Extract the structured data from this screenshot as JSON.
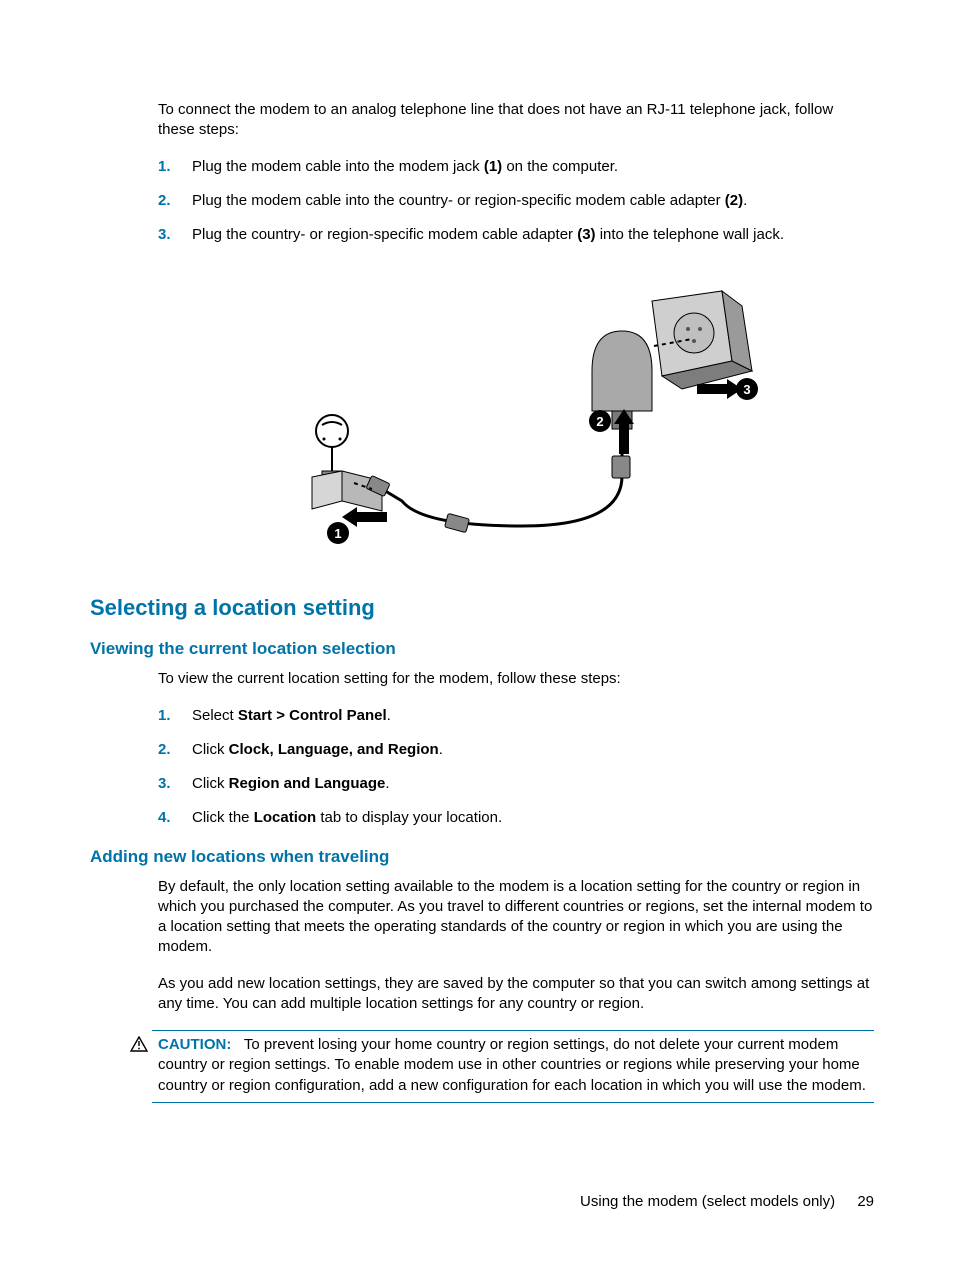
{
  "intro": "To connect the modem to an analog telephone line that does not have an RJ-11 telephone jack, follow these steps:",
  "steps1": [
    {
      "pre": "Plug the modem cable into the modem jack ",
      "bold": "(1)",
      "post": " on the computer."
    },
    {
      "pre": "Plug the modem cable into the country- or region-specific modem cable adapter ",
      "bold": "(2)",
      "post": "."
    },
    {
      "pre": "Plug the country- or region-specific modem cable adapter ",
      "bold": "(3)",
      "post": " into the telephone wall jack."
    }
  ],
  "h2": "Selecting a location setting",
  "h3a": "Viewing the current location selection",
  "view_intro": "To view the current location setting for the modem, follow these steps:",
  "steps2": [
    {
      "pre": "Select ",
      "bold": "Start > Control Panel",
      "post": "."
    },
    {
      "pre": "Click ",
      "bold": "Clock, Language, and Region",
      "post": "."
    },
    {
      "pre": "Click ",
      "bold": "Region and Language",
      "post": "."
    },
    {
      "pre": "Click the ",
      "bold": "Location",
      "post": " tab to display your location."
    }
  ],
  "h3b": "Adding new locations when traveling",
  "add_p1": "By default, the only location setting available to the modem is a location setting for the country or region in which you purchased the computer. As you travel to different countries or regions, set the internal modem to a location setting that meets the operating standards of the country or region in which you are using the modem.",
  "add_p2": "As you add new location settings, they are saved by the computer so that you can switch among settings at any time. You can add multiple location settings for any country or region.",
  "caution_label": "CAUTION:",
  "caution_body": "To prevent losing your home country or region settings, do not delete your current modem country or region settings. To enable modem use in other countries or regions while preserving your home country or region configuration, add a new configuration for each location in which you will use the modem.",
  "footer_text": "Using the modem (select models only)",
  "footer_page": "29",
  "markers": {
    "one": "1",
    "two": "2",
    "three": "3"
  }
}
